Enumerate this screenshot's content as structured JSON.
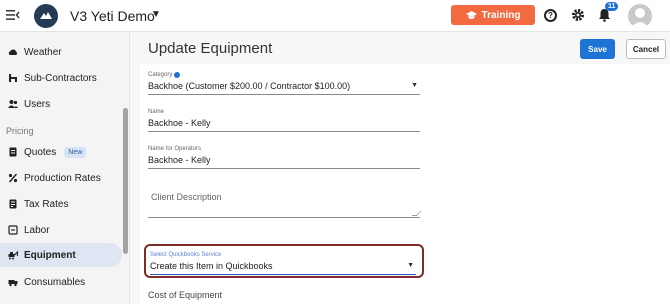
{
  "header": {
    "app_title": "V3 Yeti Demo",
    "training_label": "Training",
    "notification_count": "11"
  },
  "sidebar": {
    "items": [
      {
        "label": "Weather",
        "icon": "cloud-icon"
      },
      {
        "label": "Sub-Contractors",
        "icon": "subcontractor-icon"
      },
      {
        "label": "Users",
        "icon": "users-icon"
      }
    ],
    "section_pricing": "Pricing",
    "pricing_items": [
      {
        "label": "Quotes",
        "icon": "quotes-icon",
        "badge": "New"
      },
      {
        "label": "Production Rates",
        "icon": "percent-icon"
      },
      {
        "label": "Tax Rates",
        "icon": "tax-icon"
      },
      {
        "label": "Labor",
        "icon": "labor-icon"
      },
      {
        "label": "Equipment",
        "icon": "equipment-icon",
        "active": true
      },
      {
        "label": "Consumables",
        "icon": "consumables-icon"
      }
    ]
  },
  "main": {
    "page_title": "Update Equipment",
    "save_label": "Save",
    "cancel_label": "Cancel",
    "form": {
      "category_label": "Category",
      "category_value": "Backhoe (Customer $200.00 / Contractor $100.00)",
      "name_label": "Name",
      "name_value": "Backhoe - Kelly",
      "operators_label": "Name for Operators",
      "operators_value": "Backhoe - Kelly",
      "client_description_placeholder": "Client Description",
      "qb_service_label": "Select Quickbooks Service",
      "qb_service_value": "Create this Item in Quickbooks",
      "cost_label": "Cost of Equipment"
    }
  },
  "colors": {
    "accent": "#1e74d4",
    "training": "#f26a3f",
    "highlight_border": "#7d2b2b"
  }
}
